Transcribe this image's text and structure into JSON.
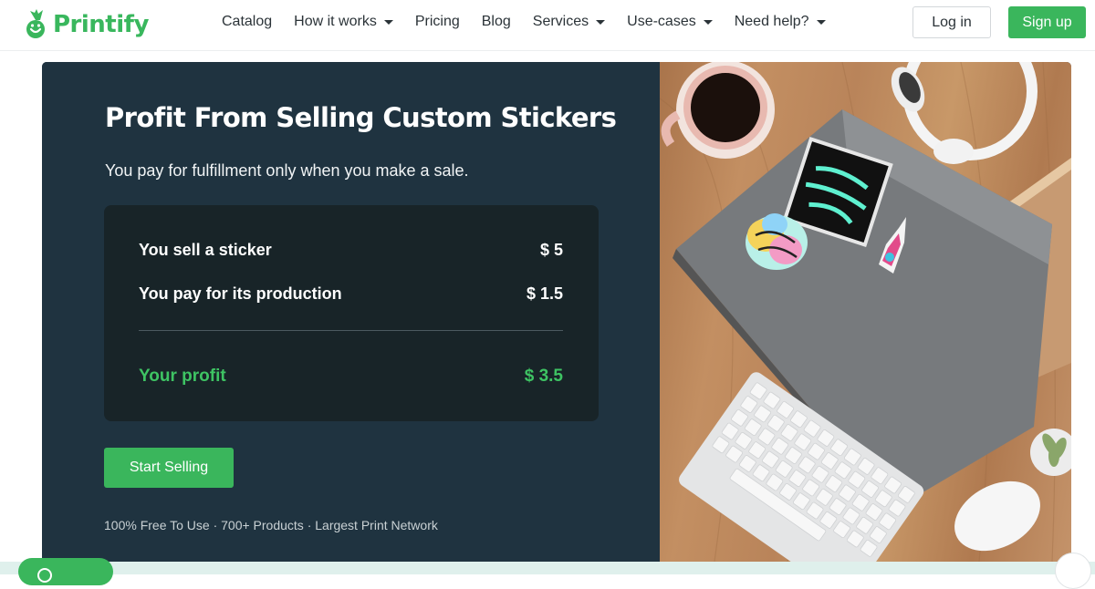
{
  "brand": {
    "name": "Printify",
    "color": "#3ab65c"
  },
  "nav": {
    "items": [
      {
        "label": "Catalog",
        "dropdown": false
      },
      {
        "label": "How it works",
        "dropdown": true
      },
      {
        "label": "Pricing",
        "dropdown": false
      },
      {
        "label": "Blog",
        "dropdown": false
      },
      {
        "label": "Services",
        "dropdown": true
      },
      {
        "label": "Use-cases",
        "dropdown": true
      },
      {
        "label": "Need help?",
        "dropdown": true
      }
    ],
    "login_label": "Log in",
    "signup_label": "Sign up"
  },
  "hero": {
    "title": "Profit From Selling Custom Stickers",
    "subtitle": "You pay for fulfillment only when you make a sale.",
    "calculator": {
      "sell_label": "You sell a sticker",
      "sell_value": "$ 5",
      "cost_label": "You pay for its production",
      "cost_value": "$ 1.5",
      "profit_label": "Your profit",
      "profit_value": "$ 3.5"
    },
    "cta_label": "Start Selling",
    "features": "100% Free To Use · 700+ Products · Largest Print Network"
  },
  "colors": {
    "panel_bg": "#1f3340",
    "calc_bg": "#182428",
    "accent": "#3ab65c",
    "profit": "#3ec363"
  }
}
